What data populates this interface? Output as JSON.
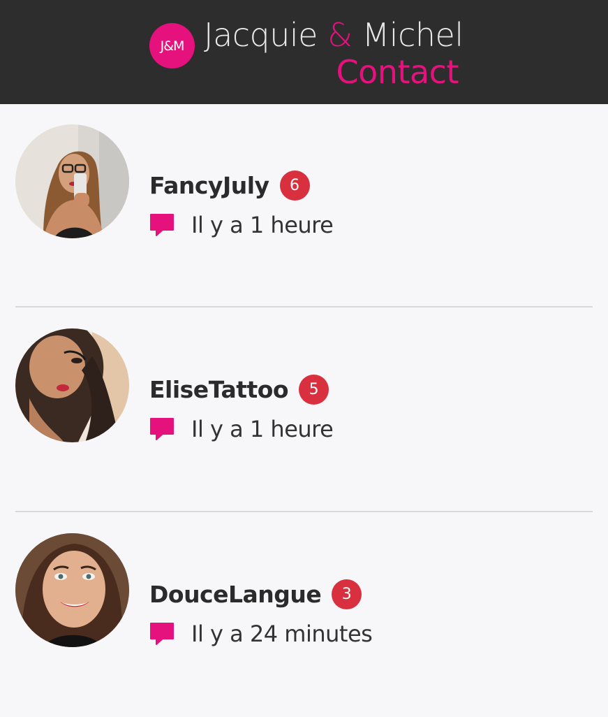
{
  "header": {
    "logo_text": "J&M",
    "brand_part1": "Jacquie ",
    "brand_amp": "&",
    "brand_part2": " Michel",
    "subtitle": "Contact",
    "brand_color": "#e5127d",
    "background": "#2e2d2e"
  },
  "contacts": [
    {
      "name": "FancyJuly",
      "unread": "6",
      "last_message": "Il y a 1 heure",
      "icon": "chat-bubble-icon"
    },
    {
      "name": "EliseTattoo",
      "unread": "5",
      "last_message": "Il y a 1 heure",
      "icon": "chat-bubble-icon"
    },
    {
      "name": "DouceLangue",
      "unread": "3",
      "last_message": "Il y a 24 minutes",
      "icon": "chat-bubble-icon"
    }
  ],
  "colors": {
    "badge": "#d9303f",
    "accent": "#e5127d",
    "background": "#f7f7f9",
    "divider": "#d8d8dc"
  }
}
